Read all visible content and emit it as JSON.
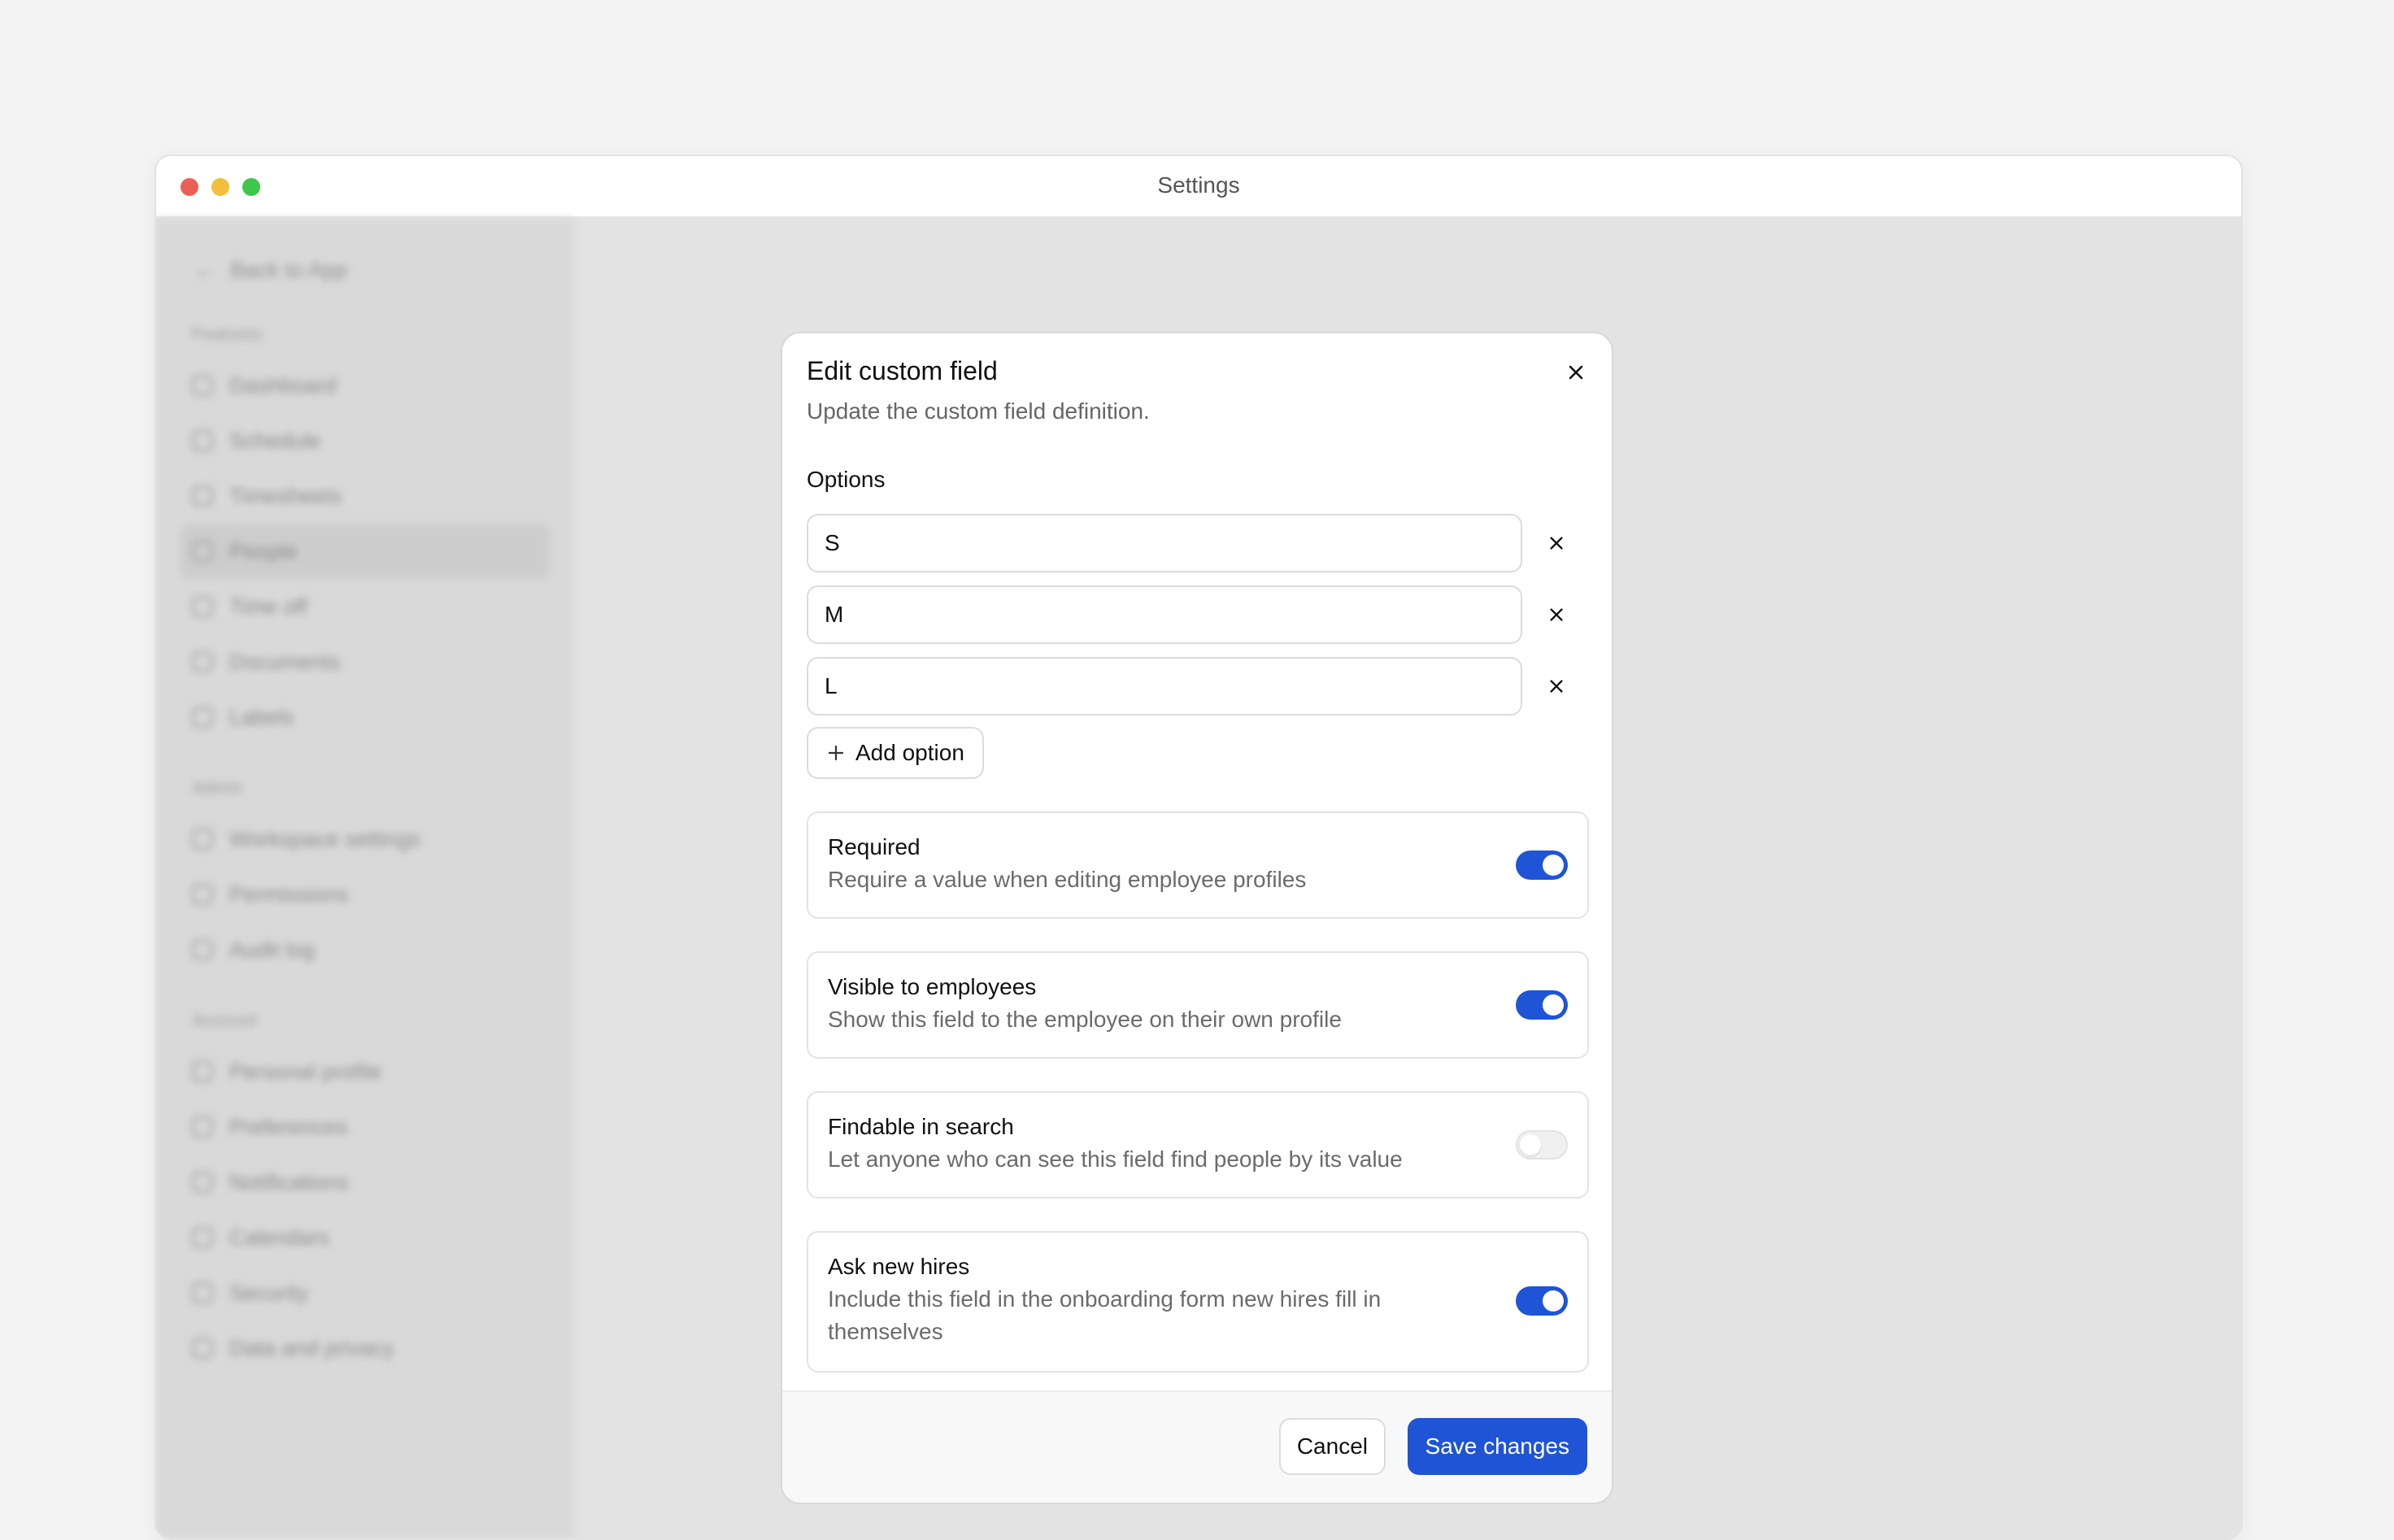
{
  "window": {
    "title": "Settings"
  },
  "sidebar": {
    "back_label": "Back to App",
    "sections": [
      {
        "title": "Features",
        "items": [
          "Dashboard",
          "Schedule",
          "Timesheets",
          "People",
          "Time off",
          "Documents",
          "Labels"
        ]
      },
      {
        "title": "Admin",
        "items": [
          "Workspace settings",
          "Permissions",
          "Audit log"
        ]
      },
      {
        "title": "Account",
        "items": [
          "Personal profile",
          "Preferences",
          "Notifications",
          "Calendars",
          "Security",
          "Data and privacy"
        ]
      }
    ],
    "active_item": "People"
  },
  "modal": {
    "title": "Edit custom field",
    "subtitle": "Update the custom field definition.",
    "options_label": "Options",
    "options": [
      "S",
      "M",
      "L"
    ],
    "add_option_label": "Add option",
    "settings": [
      {
        "title": "Required",
        "description": "Require a value when editing employee profiles",
        "enabled": true
      },
      {
        "title": "Visible to employees",
        "description": "Show this field to the employee on their own profile",
        "enabled": true
      },
      {
        "title": "Findable in search",
        "description": "Let anyone who can see this field find people by its value",
        "enabled": false
      },
      {
        "title": "Ask new hires",
        "description": "Include this field in the onboarding form new hires fill in themselves",
        "enabled": true
      }
    ],
    "cancel_label": "Cancel",
    "save_label": "Save changes"
  },
  "colors": {
    "accent": "#1f54d6",
    "backdrop": "#e3e3e3"
  },
  "icons": [
    "close-icon",
    "plus-icon"
  ]
}
